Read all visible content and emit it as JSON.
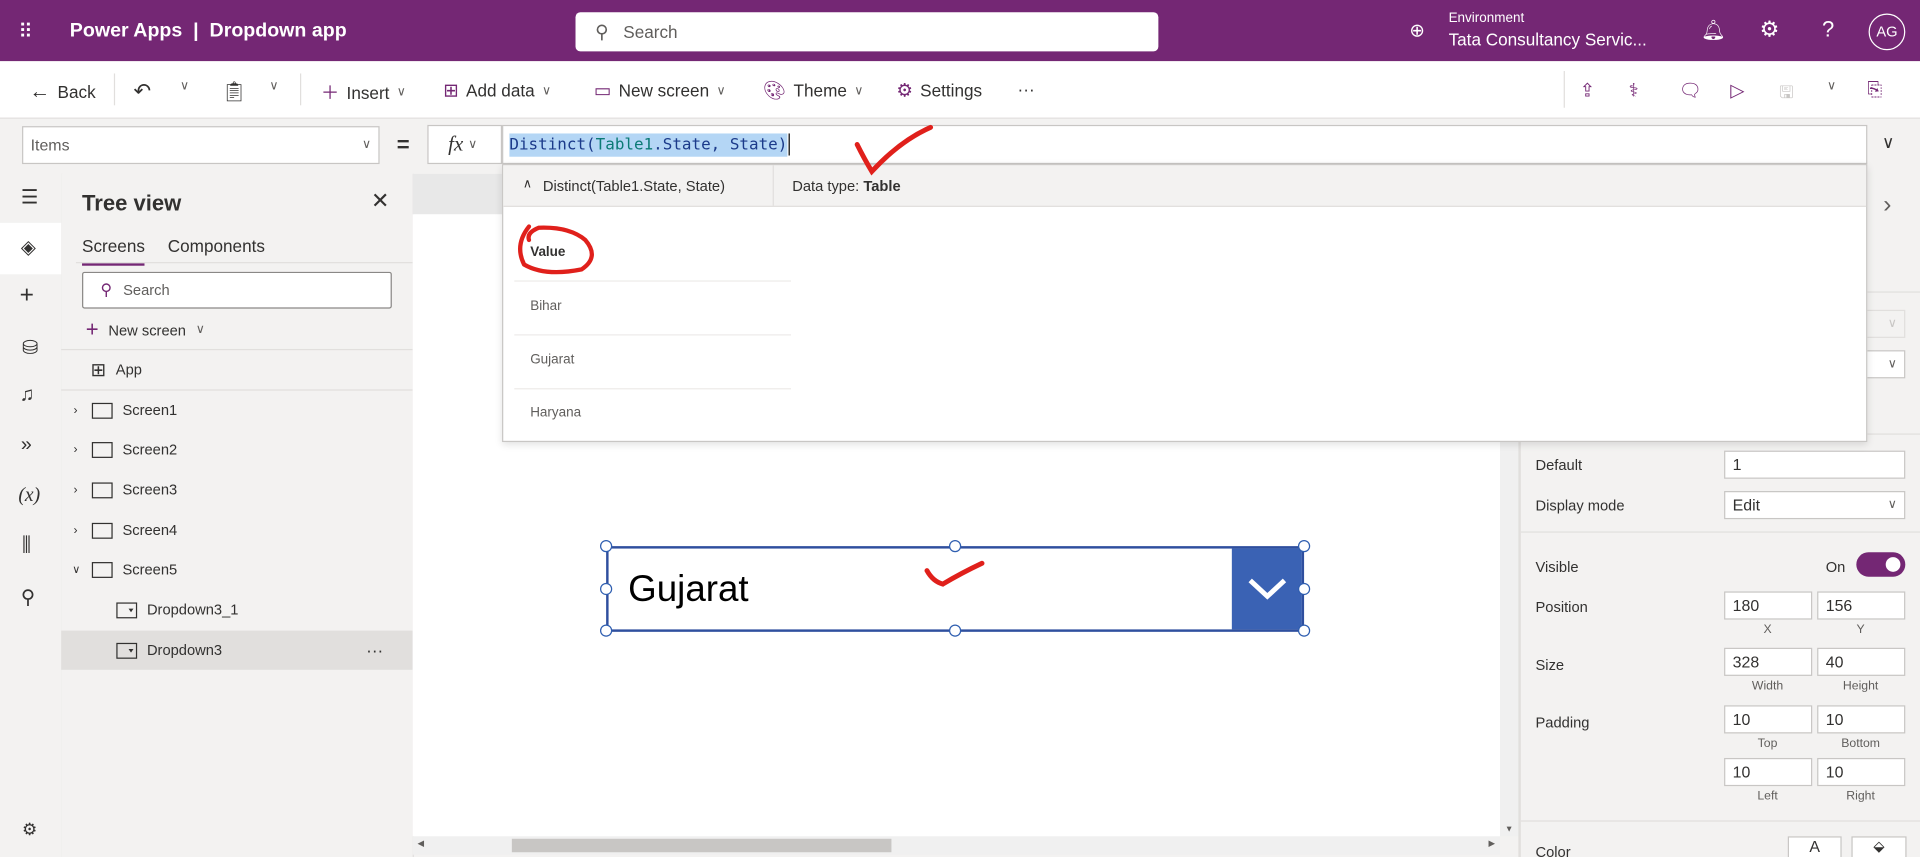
{
  "topbar": {
    "app_title": "Power Apps  |  Dropdown app",
    "search_placeholder": "Search",
    "environment_label": "Environment",
    "environment_name": "Tata Consultancy Servic...",
    "avatar_initials": "AG",
    "brand_color": "#742774"
  },
  "toolbar": {
    "back": "Back",
    "insert": "Insert",
    "add_data": "Add data",
    "new_screen": "New screen",
    "theme": "Theme",
    "settings": "Settings",
    "more": "···"
  },
  "formula_bar": {
    "property": "Items",
    "equals": "=",
    "fx": "fx",
    "formula": "Distinct(Table1.State, State)",
    "formula_parts": {
      "fn": "Distinct(",
      "table": "Table1",
      "rest": ".State, State)"
    }
  },
  "intellisense": {
    "expression": "Distinct(Table1.State, State)",
    "data_type_label": "Data type:",
    "data_type": "Table",
    "column_header": "Value",
    "rows": [
      "Bihar",
      "Gujarat",
      "Haryana"
    ]
  },
  "tree_view": {
    "title": "Tree view",
    "tabs": [
      "Screens",
      "Components"
    ],
    "active_tab": "Screens",
    "search_placeholder": "Search",
    "new_screen": "New screen",
    "app": "App",
    "screens": [
      "Screen1",
      "Screen2",
      "Screen3",
      "Screen4",
      "Screen5"
    ],
    "children": [
      "Dropdown3_1",
      "Dropdown3"
    ],
    "selected": "Dropdown3",
    "more": "···"
  },
  "canvas": {
    "dropdown_value": "Gujarat",
    "dropdown_accent": "#3a62b4"
  },
  "properties": {
    "default_label": "Default",
    "default_value": "1",
    "display_mode_label": "Display mode",
    "display_mode_value": "Edit",
    "visible_label": "Visible",
    "visible_state": "On",
    "visible_on": true,
    "position_label": "Position",
    "x": "180",
    "y": "156",
    "x_label": "X",
    "y_label": "Y",
    "size_label": "Size",
    "width": "328",
    "height": "40",
    "width_label": "Width",
    "height_label": "Height",
    "padding_label": "Padding",
    "pad_top": "10",
    "pad_bottom": "10",
    "pad_left": "10",
    "pad_right": "10",
    "top_label": "Top",
    "bottom_label": "Bottom",
    "left_label": "Left",
    "right_label": "Right",
    "color_label": "Color",
    "color_text_glyph": "A"
  },
  "annotation_color": "#e0201b"
}
